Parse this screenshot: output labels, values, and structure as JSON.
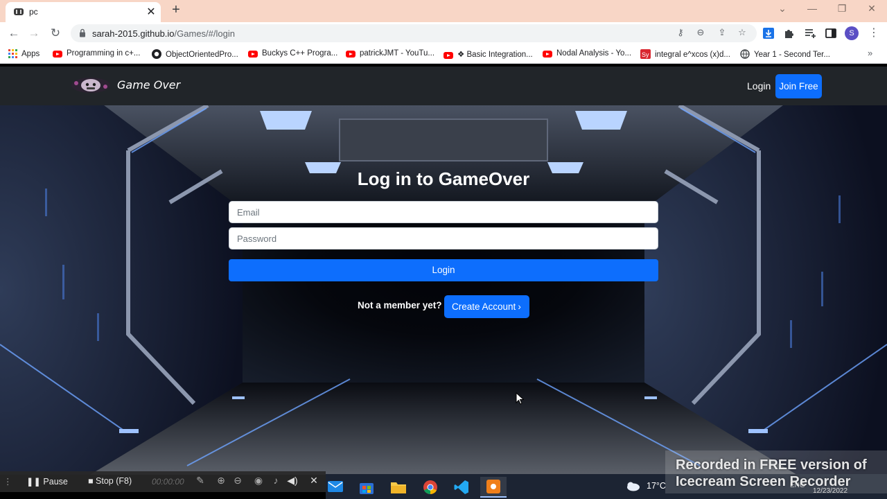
{
  "browser": {
    "tab_title": "pc",
    "url_host": "sarah-2015.github.io",
    "url_path": "/Games/#/login",
    "profile_initial": "S",
    "bookmarks": [
      {
        "label": "Apps",
        "icon": "apps-grid-icon"
      },
      {
        "label": "Programming in c+...",
        "icon": "youtube-icon"
      },
      {
        "label": "ObjectOrientedPro...",
        "icon": "github-icon"
      },
      {
        "label": "Buckys C++ Progra...",
        "icon": "youtube-icon"
      },
      {
        "label": "patrickJMT - YouTu...",
        "icon": "youtube-icon"
      },
      {
        "label": "❖ Basic Integration...",
        "icon": "youtube-icon"
      },
      {
        "label": "Nodal Analysis - Yo...",
        "icon": "youtube-icon"
      },
      {
        "label": "integral e^xcos (x)d...",
        "icon": "symbolab-icon"
      },
      {
        "label": "Year 1 - Second Ter...",
        "icon": "globe-icon"
      }
    ]
  },
  "site": {
    "brand": "Game Over",
    "nav_login": "Login",
    "nav_join": "Join Free",
    "login_title": "Log in to GameOver",
    "email_placeholder": "Email",
    "password_placeholder": "Password",
    "login_button": "Login",
    "not_member": "Not a member yet?",
    "create_account": "Create Account"
  },
  "recorder": {
    "pause": "Pause",
    "stop": "Stop (F8)",
    "time": "00:00:00"
  },
  "taskbar": {
    "temperature": "17°C",
    "language": "ENG",
    "date": "12/23/2022"
  },
  "watermark": {
    "line1": "Recorded in FREE version of",
    "line2": "Icecream Screen Recorder"
  },
  "colors": {
    "primary": "#0d6efd",
    "navbar": "#212529",
    "tabbar": "#f8d6c6"
  }
}
